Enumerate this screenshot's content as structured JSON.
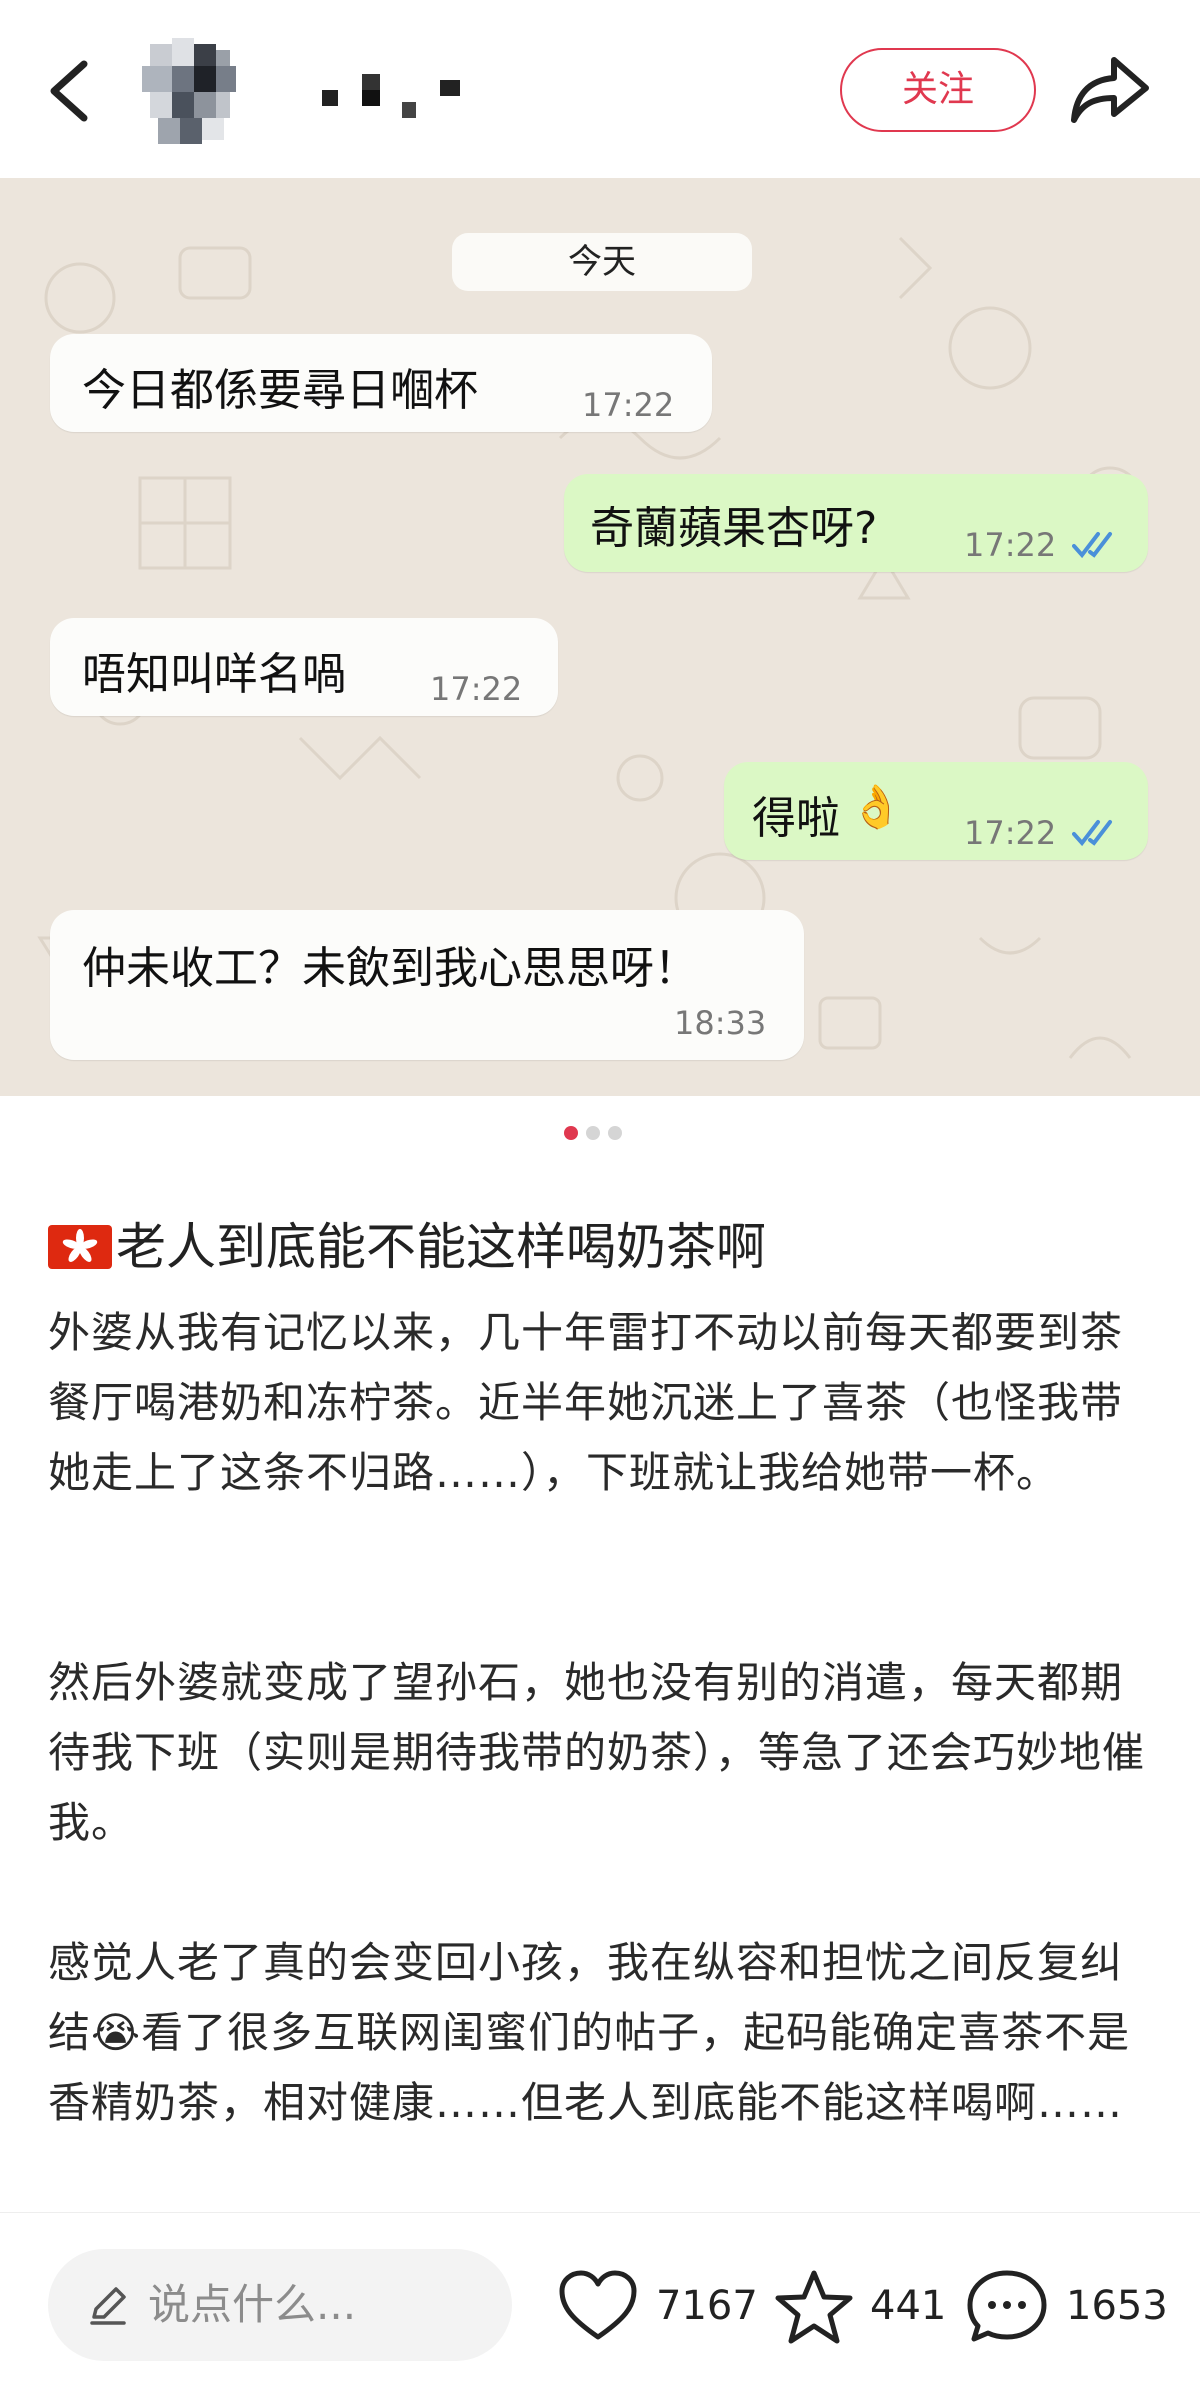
{
  "header": {
    "back_icon": "chevron-left-icon",
    "follow_label": "关注",
    "share_icon": "share-arrow-icon",
    "accent_color": "#e0384f"
  },
  "chat": {
    "date_label": "今天",
    "messages": [
      {
        "direction": "incoming",
        "text": "今日都係要尋日嗰杯",
        "time": "17:22"
      },
      {
        "direction": "outgoing",
        "text": "奇蘭蘋果杏呀?",
        "time": "17:22",
        "status_icon": "double-check-icon"
      },
      {
        "direction": "incoming",
        "text": "唔知叫咩名喎",
        "time": "17:22"
      },
      {
        "direction": "outgoing",
        "text": "得啦",
        "emoji": "👌",
        "time": "17:22",
        "status_icon": "double-check-icon"
      },
      {
        "direction": "incoming",
        "text": "仲未收工？未飲到我心思思呀！",
        "time": "18:33"
      }
    ]
  },
  "carousel": {
    "current": 1,
    "total": 3
  },
  "post": {
    "flag_icon": "hong-kong-flag-icon",
    "title": "老人到底能不能这样喝奶茶啊",
    "paragraphs": [
      "外婆从我有记忆以来，几十年雷打不动以前每天都要到茶餐厅喝港奶和冻柠茶。近半年她沉迷上了喜茶（也怪我带她走上了这条不归路……），下班就让我给她带一杯。",
      "然后外婆就变成了望孙石，她也没有别的消遣，每天都期待我下班（实则是期待我带的奶茶），等急了还会巧妙地催我。",
      "感觉人老了真的会变回小孩，我在纵容和担忧之间反复纠结😭看了很多互联网闺蜜们的帖子，起码能确定喜茶不是香精奶茶，相对健康……但老人到底能不能这样喝啊……"
    ]
  },
  "bottom_bar": {
    "comment_placeholder": "说点什么...",
    "likes": "7167",
    "favorites": "441",
    "comments": "1653"
  }
}
